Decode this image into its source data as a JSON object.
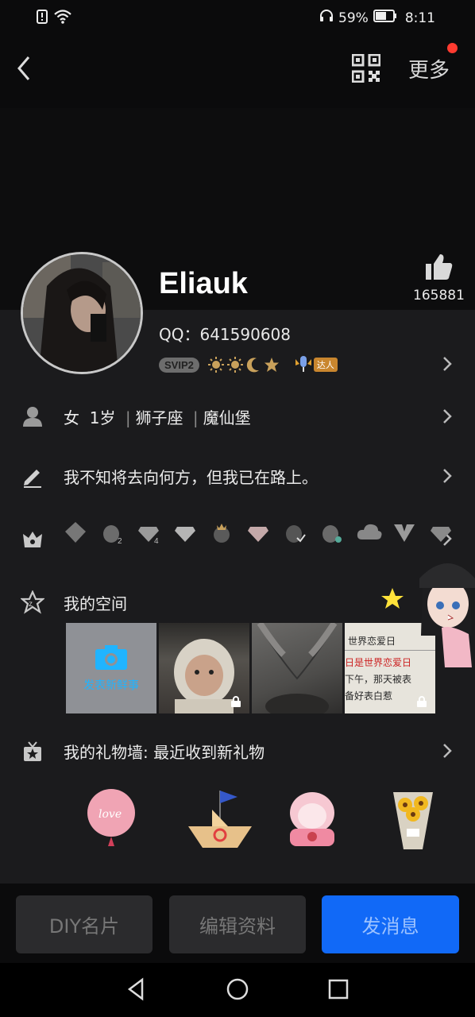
{
  "status_bar": {
    "battery_percent": "59%",
    "time": "8:11"
  },
  "header": {
    "more_label": "更多"
  },
  "profile": {
    "name": "Eliauk",
    "likes_count": "165881",
    "qq_label": "QQ：641590608",
    "svip_badge": "SVIP2",
    "talent_badge": "达人"
  },
  "rows": {
    "basic_info": {
      "gender": "女",
      "age": "1岁",
      "zodiac": "狮子座",
      "location": "魔仙堡",
      "sep": "|"
    },
    "signature": "我不知将去向何方，但我已在路上。",
    "space_title": "我的空间",
    "gift_wall": "我的礼物墙: 最近收到新礼物"
  },
  "space": {
    "post_label": "发表新鲜事",
    "tile3_lines": [
      "世界恋爱日",
      "日是世界恋爱日",
      "下午，那天被表",
      "备好表白惹"
    ]
  },
  "buttons": {
    "diy": "DIY名片",
    "edit": "编辑资料",
    "message": "发消息"
  },
  "colors": {
    "accent_blue": "#1169f7",
    "camera_blue": "#20b4ff",
    "notify_red": "#ff3b30"
  }
}
